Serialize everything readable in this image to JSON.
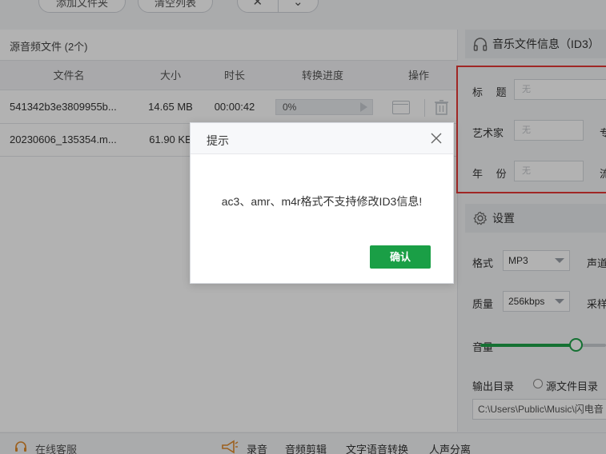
{
  "toolbar": {
    "add_folder": "添加文件夹",
    "clear_list": "清空列表",
    "close_symbol": "✕",
    "expand_symbol": "⌄"
  },
  "file_list": {
    "title": "源音频文件 (2个)",
    "columns": [
      "文件名",
      "大小",
      "时长",
      "转换进度",
      "操作"
    ],
    "rows": [
      {
        "name": "541342b3e3809955b...",
        "size": "14.65 MB",
        "duration": "00:00:42",
        "progress": "0%"
      },
      {
        "name": "20230606_135354.m...",
        "size": "61.90 KB",
        "duration": "",
        "progress": ""
      }
    ]
  },
  "id3": {
    "section_title": "音乐文件信息（ID3）",
    "fields": {
      "title_label": "标  题",
      "title_value": "无",
      "artist_label": "艺术家",
      "artist_value": "无",
      "album_label_partial": "专",
      "year_label": "年  份",
      "year_value": "无",
      "genre_label_partial": "流"
    }
  },
  "settings": {
    "section_title": "设置",
    "format_label": "格式",
    "format_value": "MP3",
    "channel_label_partial": "声道",
    "quality_label": "质量",
    "quality_value": "256kbps",
    "sample_label_partial": "采样",
    "volume_label": "音量",
    "volume_level": 0.72,
    "output_label": "输出目录",
    "output_option": "源文件目录",
    "output_path": "C:\\Users\\Public\\Music\\闪电音"
  },
  "bottom": {
    "support": "在线客服",
    "record": "录音",
    "audio_edit": "音频剪辑",
    "tts": "文字语音转换",
    "vocal_split": "人声分离"
  },
  "dialog": {
    "title": "提示",
    "message": "ac3、amr、m4r格式不支持修改ID3信息!",
    "confirm": "确认"
  },
  "colors": {
    "accent_green": "#1a9f46",
    "highlight_red": "#e53935",
    "overlay": "rgba(0,0,0,0.30)"
  }
}
